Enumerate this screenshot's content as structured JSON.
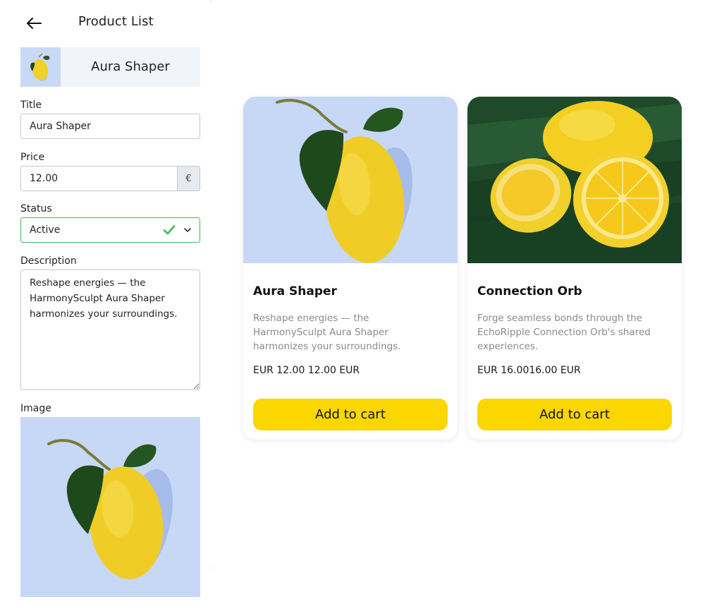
{
  "header": {
    "title": "Product List",
    "back_icon": "arrow-left-icon"
  },
  "product_tile": {
    "name": "Aura Shaper"
  },
  "form": {
    "title_label": "Title",
    "title_value": "Aura Shaper",
    "price_label": "Price",
    "price_value": "12.00",
    "currency_symbol": "€",
    "status_label": "Status",
    "status_value": "Active",
    "status_icon": "check-icon",
    "description_label": "Description",
    "description_value": "Reshape energies — the HarmonySculpt Aura Shaper harmonizes your surroundings.",
    "image_label": "Image"
  },
  "products": [
    {
      "title": "Aura Shaper",
      "description": "Reshape energies — the HarmonySculpt Aura Shaper harmonizes your surroundings.",
      "price": "EUR 12.00 12.00 EUR",
      "button_label": "Add to cart"
    },
    {
      "title": "Connection Orb",
      "description": "Forge seamless bonds through the EchoRipple Connection Orb's shared experiences.",
      "price": "EUR 16.0016.00 EUR",
      "button_label": "Add to cart"
    }
  ],
  "colors": {
    "accent_yellow": "#fbd600",
    "status_green": "#3cb960",
    "tile_background": "#f1f4f8"
  }
}
